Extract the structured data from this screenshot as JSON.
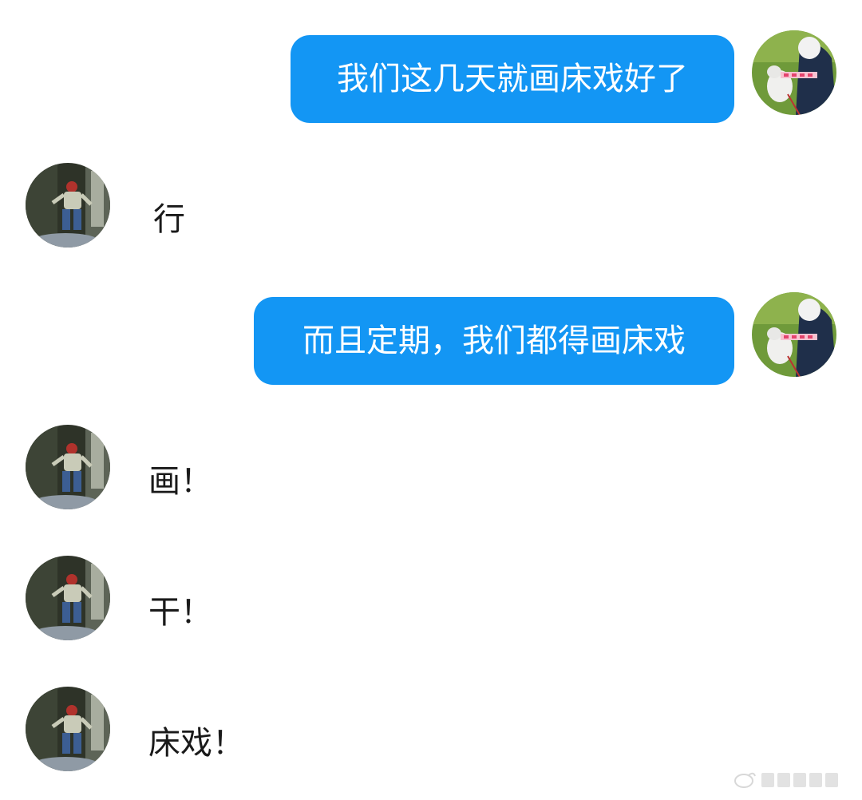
{
  "conversation": {
    "messages": [
      {
        "sender": "self",
        "text": "我们这几天就画床戏好了"
      },
      {
        "sender": "peer",
        "text": "行"
      },
      {
        "sender": "self",
        "text": "而且定期，我们都得画床戏"
      },
      {
        "sender": "peer",
        "text": "画！"
      },
      {
        "sender": "peer",
        "text": "干！"
      },
      {
        "sender": "peer",
        "text": "床戏！"
      }
    ]
  },
  "colors": {
    "outgoing_bubble": "#1396f4",
    "outgoing_text": "#ffffff",
    "incoming_text": "#1a1a1a"
  },
  "icons": {
    "self_avatar": "avatar-grass-dog-photo",
    "peer_avatar": "avatar-dark-room-figure-photo",
    "watermark": "watermark-logo"
  }
}
